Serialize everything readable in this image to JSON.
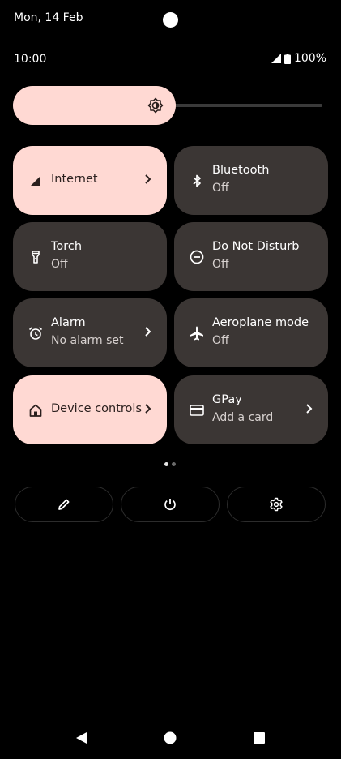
{
  "status_bar": {
    "date": "Mon, 14 Feb",
    "time": "10:00",
    "battery": "100%"
  },
  "brightness": {
    "level_percent": 50,
    "icon": "brightness-icon"
  },
  "tiles": [
    {
      "title": "Internet",
      "subtitle": "",
      "active": true,
      "has_chevron": true,
      "icon": "signal-icon"
    },
    {
      "title": "Bluetooth",
      "subtitle": "Off",
      "active": false,
      "has_chevron": false,
      "icon": "bluetooth-icon"
    },
    {
      "title": "Torch",
      "subtitle": "Off",
      "active": false,
      "has_chevron": false,
      "icon": "torch-icon"
    },
    {
      "title": "Do Not Disturb",
      "subtitle": "Off",
      "active": false,
      "has_chevron": false,
      "icon": "do-not-disturb-icon"
    },
    {
      "title": "Alarm",
      "subtitle": "No alarm set",
      "active": false,
      "has_chevron": true,
      "icon": "alarm-icon"
    },
    {
      "title": "Aeroplane mode",
      "subtitle": "Off",
      "active": false,
      "has_chevron": false,
      "icon": "airplane-icon"
    },
    {
      "title": "Device controls",
      "subtitle": "",
      "active": true,
      "has_chevron": true,
      "icon": "home-icon"
    },
    {
      "title": "GPay",
      "subtitle": "Add a card",
      "active": false,
      "has_chevron": true,
      "icon": "card-icon"
    }
  ],
  "pager": {
    "pages": 2,
    "current": 1
  },
  "actions": [
    {
      "icon": "edit-icon"
    },
    {
      "icon": "power-icon"
    },
    {
      "icon": "gear-icon"
    }
  ],
  "nav": [
    {
      "icon": "back-icon"
    },
    {
      "icon": "home-circle-icon"
    },
    {
      "icon": "recents-icon"
    }
  ],
  "colors": {
    "active_tile": "#ffd9d3",
    "inactive_tile": "#3b3634",
    "background": "#000000"
  }
}
